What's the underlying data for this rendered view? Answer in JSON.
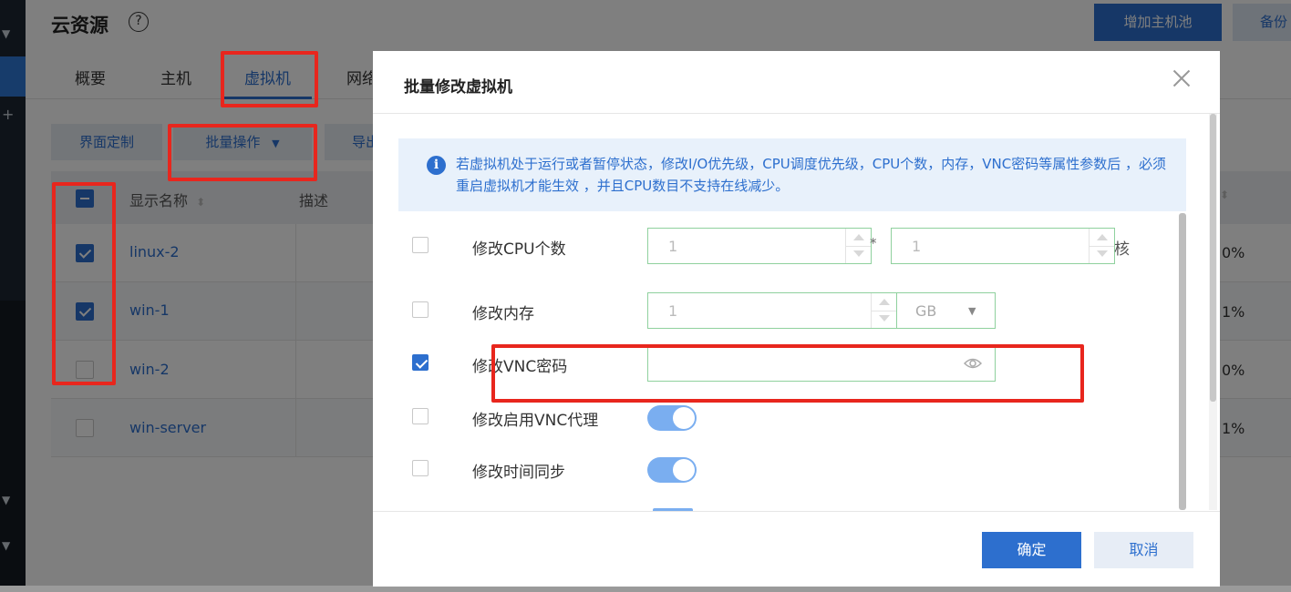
{
  "page": {
    "title": "云资源",
    "help_icon": "?",
    "add_pool_button": "增加主机池",
    "backup_button": "备份",
    "tabs": [
      "概要",
      "主机",
      "虚拟机",
      "网络"
    ],
    "active_tab": "虚拟机",
    "toolbar": {
      "customize": "界面定制",
      "batch_ops": "批量操作",
      "export": "导出"
    },
    "table": {
      "headers": [
        "显示名称",
        "描述"
      ],
      "rows": [
        {
          "name": "linux-2",
          "checked": true,
          "pct": "0%"
        },
        {
          "name": "win-1",
          "checked": true,
          "pct": "1%"
        },
        {
          "name": "win-2",
          "checked": false,
          "pct": "0%"
        },
        {
          "name": "win-server",
          "checked": false,
          "pct": "1%"
        }
      ]
    }
  },
  "modal": {
    "title": "批量修改虚拟机",
    "notice": "若虚拟机处于运行或者暂停状态，修改I/O优先级，CPU调度优先级，CPU个数，内存，VNC密码等属性参数后 ，必须重启虚拟机才能生效 ，并且CPU数目不支持在线减少。",
    "fields": {
      "cpu": {
        "label": "修改CPU个数",
        "sockets": "1",
        "times": "*",
        "cores": "1",
        "unit": "核",
        "checked": false
      },
      "memory": {
        "label": "修改内存",
        "value": "1",
        "unit": "GB",
        "checked": false
      },
      "vnc_password": {
        "label": "修改VNC密码",
        "value": "",
        "checked": true
      },
      "vnc_proxy": {
        "label": "修改启用VNC代理",
        "enabled": true,
        "checked": false
      },
      "time_sync": {
        "label": "修改时间同步",
        "enabled": true,
        "checked": false
      }
    },
    "ok_button": "确定",
    "cancel_button": "取消"
  },
  "colors": {
    "primary": "#2d6fce",
    "annotation_red": "#e8261d",
    "input_border": "#8fd19e"
  }
}
